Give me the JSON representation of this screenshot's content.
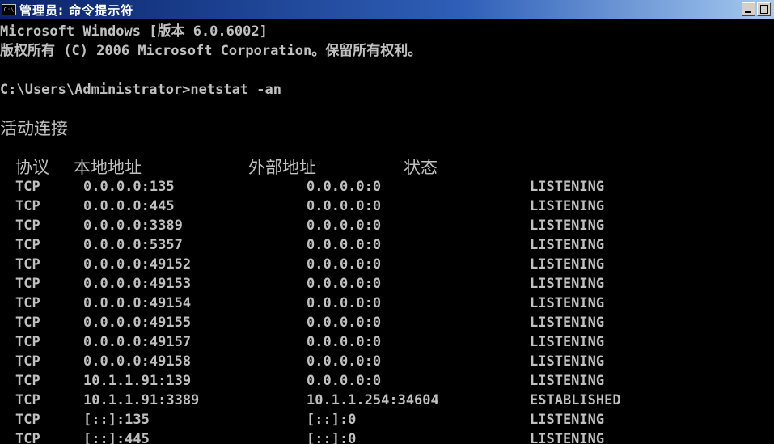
{
  "window": {
    "title": "管理员: 命令提示符",
    "icon_label": "C:\\"
  },
  "console": {
    "version_line": "Microsoft Windows [版本 6.0.6002]",
    "copyright_line": "版权所有 (C) 2006 Microsoft Corporation。保留所有权利。",
    "prompt_line": "C:\\Users\\Administrator>netstat -an",
    "active_connections": "活动连接",
    "headers": {
      "proto": "协议",
      "local": "本地地址",
      "foreign": "外部地址",
      "state": "状态"
    },
    "rows": [
      {
        "proto": "TCP",
        "local": "0.0.0.0:135",
        "foreign": "0.0.0.0:0",
        "state": "LISTENING"
      },
      {
        "proto": "TCP",
        "local": "0.0.0.0:445",
        "foreign": "0.0.0.0:0",
        "state": "LISTENING"
      },
      {
        "proto": "TCP",
        "local": "0.0.0.0:3389",
        "foreign": "0.0.0.0:0",
        "state": "LISTENING"
      },
      {
        "proto": "TCP",
        "local": "0.0.0.0:5357",
        "foreign": "0.0.0.0:0",
        "state": "LISTENING"
      },
      {
        "proto": "TCP",
        "local": "0.0.0.0:49152",
        "foreign": "0.0.0.0:0",
        "state": "LISTENING"
      },
      {
        "proto": "TCP",
        "local": "0.0.0.0:49153",
        "foreign": "0.0.0.0:0",
        "state": "LISTENING"
      },
      {
        "proto": "TCP",
        "local": "0.0.0.0:49154",
        "foreign": "0.0.0.0:0",
        "state": "LISTENING"
      },
      {
        "proto": "TCP",
        "local": "0.0.0.0:49155",
        "foreign": "0.0.0.0:0",
        "state": "LISTENING"
      },
      {
        "proto": "TCP",
        "local": "0.0.0.0:49157",
        "foreign": "0.0.0.0:0",
        "state": "LISTENING"
      },
      {
        "proto": "TCP",
        "local": "0.0.0.0:49158",
        "foreign": "0.0.0.0:0",
        "state": "LISTENING"
      },
      {
        "proto": "TCP",
        "local": "10.1.1.91:139",
        "foreign": "0.0.0.0:0",
        "state": "LISTENING"
      },
      {
        "proto": "TCP",
        "local": "10.1.1.91:3389",
        "foreign": "10.1.1.254:34604",
        "state": "ESTABLISHED"
      },
      {
        "proto": "TCP",
        "local": "[::]:135",
        "foreign": "[::]:0",
        "state": "LISTENING"
      },
      {
        "proto": "TCP",
        "local": "[::]:445",
        "foreign": "[::]:0",
        "state": "LISTENING"
      }
    ]
  },
  "colors": {
    "console_bg": "#000000",
    "console_text": "#c0c0c0",
    "titlebar_start": "#0a246a",
    "titlebar_end": "#a6caf0"
  }
}
